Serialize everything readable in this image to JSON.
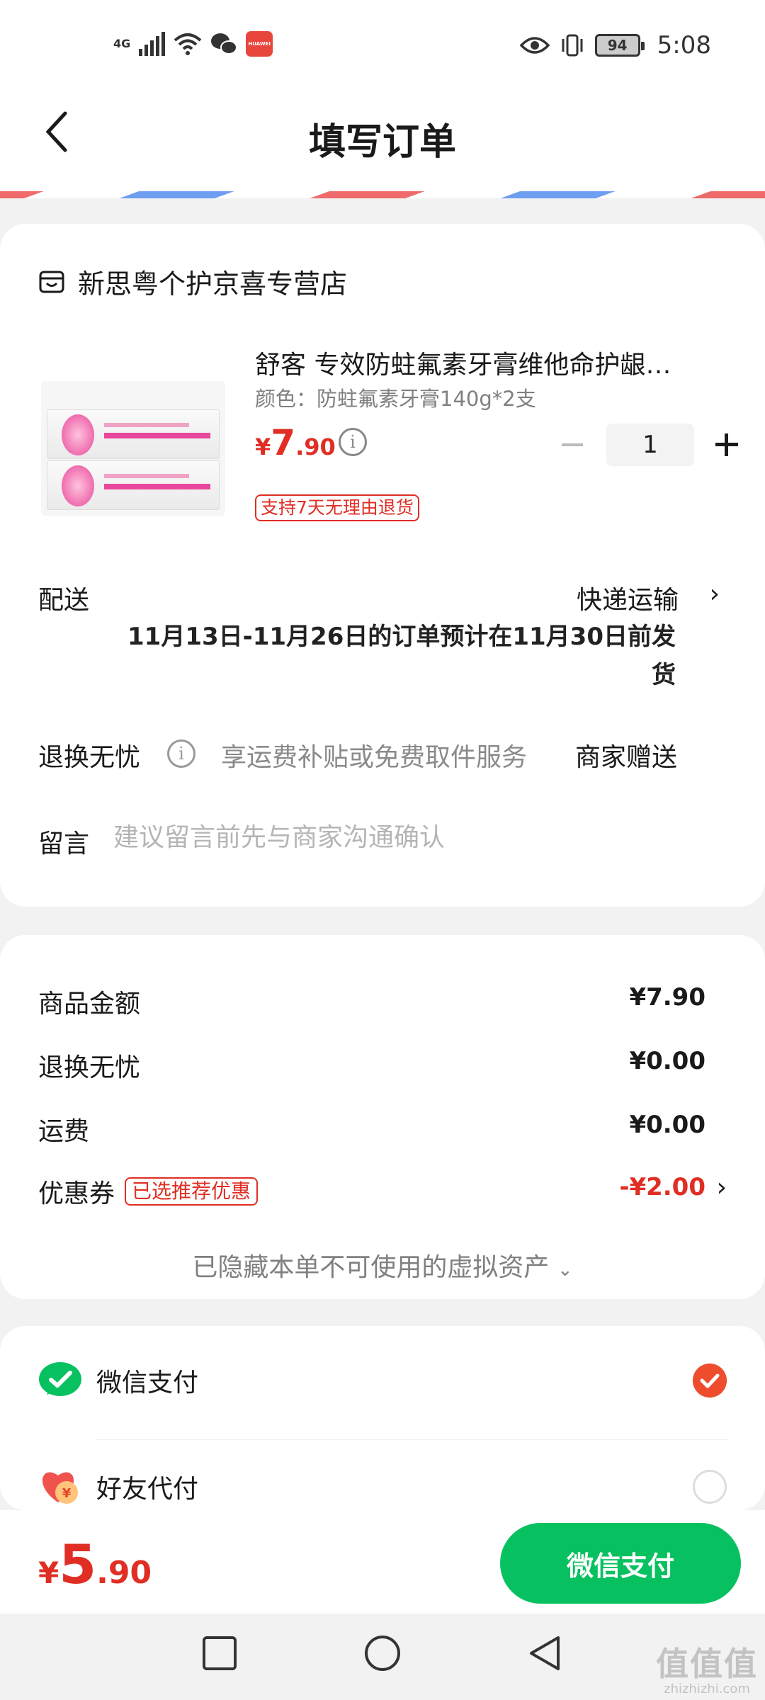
{
  "status_bar": {
    "network": "4G",
    "battery": "94",
    "time": "5:08",
    "app_badge": "HUAWEI"
  },
  "header": {
    "title": "填写订单"
  },
  "store": {
    "name": "新思粤个护京喜专营店"
  },
  "product": {
    "name": "舒客 专效防蛀氟素牙膏维他命护龈…",
    "spec": "颜色：防蛀氟素牙膏140g*2支",
    "price_symbol": "¥",
    "price_int": "7",
    "price_dec": ".90",
    "quantity": "1",
    "return_tag": "支持7天无理由退货"
  },
  "delivery": {
    "label": "配送",
    "value": "快递运输",
    "note": "11月13日-11月26日的订单预计在11月30日前发货"
  },
  "return_service": {
    "label": "退换无忧",
    "desc": "享运费补贴或免费取件服务",
    "value": "商家赠送"
  },
  "message": {
    "label": "留言",
    "placeholder": "建议留言前先与商家沟通确认"
  },
  "summary": {
    "goods_label": "商品金额",
    "goods_value": "¥7.90",
    "return_label": "退换无忧",
    "return_value": "¥0.00",
    "shipping_label": "运费",
    "shipping_value": "¥0.00",
    "coupon_label": "优惠券",
    "coupon_tag": "已选推荐优惠",
    "coupon_value": "-¥2.00",
    "hidden_assets": "已隐藏本单不可使用的虚拟资产"
  },
  "payment": {
    "wechat_label": "微信支付",
    "friend_label": "好友代付",
    "wechat_selected": true
  },
  "bottom": {
    "total_symbol": "¥",
    "total_int": "5",
    "total_dec": ".90",
    "pay_button": "微信支付"
  },
  "watermark": {
    "logo": "值值值",
    "url": "zhizhizhi.com"
  },
  "colors": {
    "accent_red": "#e02e24",
    "wechat_green": "#07c160",
    "radio_orange": "#ee4d2d"
  }
}
